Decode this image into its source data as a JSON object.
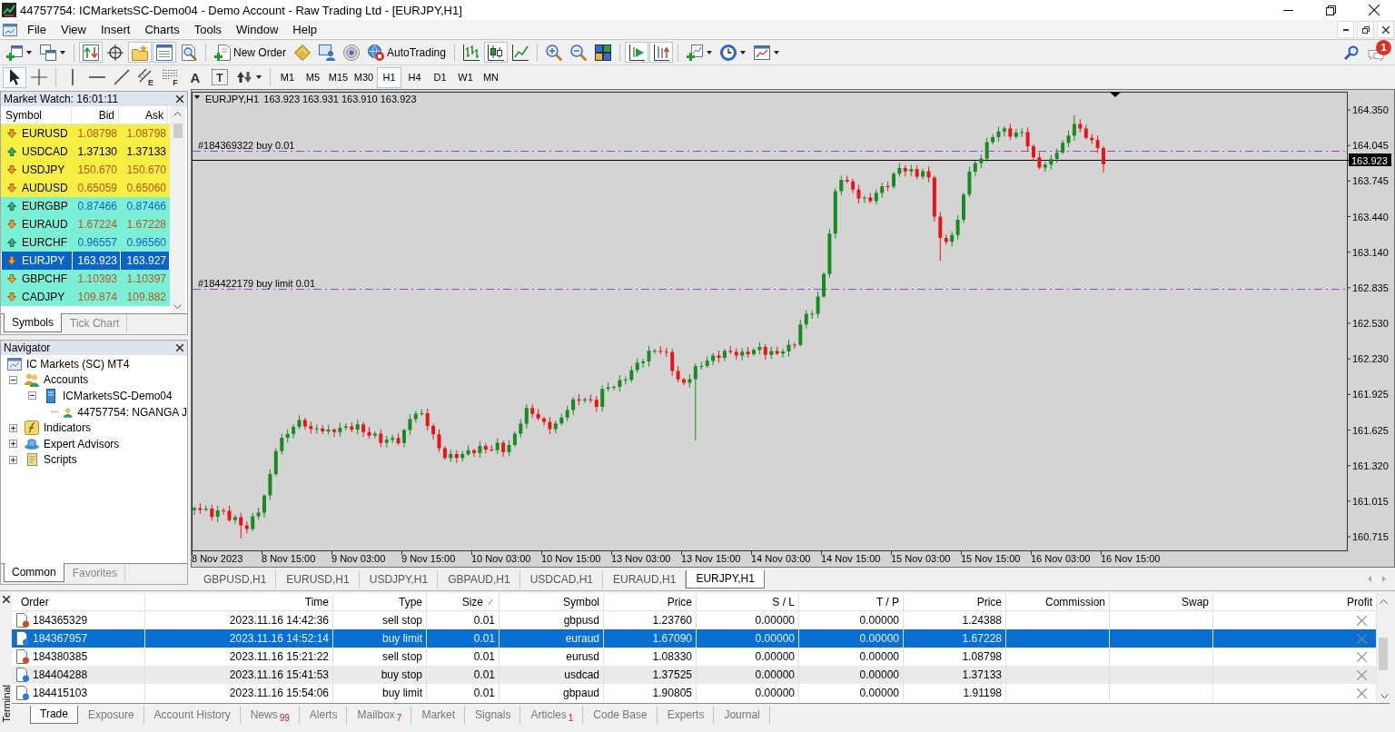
{
  "window": {
    "title": "44757754: ICMarketsSC-Demo04 - Demo Account - Raw Trading Ltd - [EURJPY,H1]"
  },
  "menu": [
    "File",
    "View",
    "Insert",
    "Charts",
    "Tools",
    "Window",
    "Help"
  ],
  "toolbar": [
    [
      {
        "kind": "newchart",
        "on": false
      },
      {
        "kind": "profiles",
        "on": false
      }
    ],
    [
      {
        "kind": "marketwatch",
        "on": true
      },
      {
        "kind": "datawindow",
        "on": false
      },
      {
        "kind": "navigator",
        "on": true
      },
      {
        "kind": "terminal",
        "on": true
      },
      {
        "kind": "tester",
        "on": false
      }
    ],
    [
      {
        "kind": "neworder",
        "label": "New Order",
        "on": false
      },
      {
        "kind": "editor",
        "on": false
      },
      {
        "kind": "signals",
        "on": false
      },
      {
        "kind": "vps",
        "on": false
      },
      {
        "kind": "autotrading",
        "label": "AutoTrading",
        "on": false
      }
    ],
    [
      {
        "kind": "bars",
        "on": false
      },
      {
        "kind": "candles",
        "on": true
      },
      {
        "kind": "line",
        "on": false
      }
    ],
    [
      {
        "kind": "zoomin",
        "on": false
      },
      {
        "kind": "zoomout",
        "on": false
      },
      {
        "kind": "tile",
        "on": false
      }
    ],
    [
      {
        "kind": "autoscroll",
        "on": true
      },
      {
        "kind": "shift",
        "on": true
      }
    ],
    [
      {
        "kind": "indicators",
        "on": false
      },
      {
        "kind": "periods",
        "on": false
      },
      {
        "kind": "templates",
        "on": false
      }
    ]
  ],
  "notifications": {
    "badge": "1"
  },
  "drawing_tools": [
    [
      {
        "kind": "cursor",
        "on": true
      },
      {
        "kind": "crosshair",
        "on": false
      }
    ],
    [
      {
        "kind": "vline",
        "on": false
      },
      {
        "kind": "hline",
        "on": false
      },
      {
        "kind": "trend",
        "on": false
      },
      {
        "kind": "channel",
        "glyph": "E",
        "on": false
      },
      {
        "kind": "fibo",
        "glyph": "F",
        "on": false
      },
      {
        "kind": "text",
        "glyph": "A",
        "on": false
      },
      {
        "kind": "label",
        "glyph": "T",
        "on": false
      },
      {
        "kind": "arrows",
        "on": false
      }
    ]
  ],
  "timeframes": [
    {
      "label": "M1",
      "selected": false
    },
    {
      "label": "M5",
      "selected": false
    },
    {
      "label": "M15",
      "selected": false
    },
    {
      "label": "M30",
      "selected": false
    },
    {
      "label": "H1",
      "selected": true
    },
    {
      "label": "H4",
      "selected": false
    },
    {
      "label": "D1",
      "selected": false
    },
    {
      "label": "W1",
      "selected": false
    },
    {
      "label": "MN",
      "selected": false
    }
  ],
  "market_watch": {
    "title": "Market Watch: 16:01:11",
    "columns": [
      "Symbol",
      "Bid",
      "Ask"
    ],
    "rows": [
      {
        "symbol": "EURUSD",
        "bid": "1.08798",
        "ask": "1.08798",
        "kind": "fall",
        "price_up": false,
        "price_down": true,
        "color": "#f6ee42",
        "selected": false
      },
      {
        "symbol": "USDCAD",
        "bid": "1.37130",
        "ask": "1.37133",
        "kind": "rise",
        "price_up": false,
        "price_down": false,
        "color": "#f6ee42",
        "selected": false
      },
      {
        "symbol": "USDJPY",
        "bid": "150.670",
        "ask": "150.670",
        "kind": "fall",
        "price_up": false,
        "price_down": true,
        "color": "#f6ee42",
        "selected": false
      },
      {
        "symbol": "AUDUSD",
        "bid": "0.65059",
        "ask": "0.65060",
        "kind": "fall",
        "price_up": false,
        "price_down": true,
        "color": "#f6ee42",
        "selected": false
      },
      {
        "symbol": "EURGBP",
        "bid": "0.87466",
        "ask": "0.87466",
        "kind": "rise",
        "price_up": true,
        "price_down": false,
        "color": "#7cf0d6",
        "selected": false
      },
      {
        "symbol": "EURAUD",
        "bid": "1.67224",
        "ask": "1.67228",
        "kind": "fall",
        "price_up": false,
        "price_down": true,
        "color": "#7cf0d6",
        "selected": false
      },
      {
        "symbol": "EURCHF",
        "bid": "0.96557",
        "ask": "0.96560",
        "kind": "rise",
        "price_up": true,
        "price_down": false,
        "color": "#7cf0d6",
        "selected": false
      },
      {
        "symbol": "EURJPY",
        "bid": "163.923",
        "ask": "163.927",
        "kind": "fall",
        "selected": true
      },
      {
        "symbol": "GBPCHF",
        "bid": "1.10393",
        "ask": "1.10397",
        "kind": "fall",
        "price_up": false,
        "price_down": true,
        "color": "#7cf0d6",
        "selected": false
      },
      {
        "symbol": "CADJPY",
        "bid": "109.874",
        "ask": "109.882",
        "kind": "fall",
        "price_up": false,
        "price_down": true,
        "color": "#7cf0d6",
        "selected": false
      }
    ],
    "tabs": [
      {
        "label": "Symbols",
        "selected": true
      },
      {
        "label": "Tick Chart",
        "selected": false
      }
    ]
  },
  "navigator": {
    "title": "Navigator",
    "tree": [
      {
        "label": "IC Markets (SC) MT4",
        "kind": "terminal",
        "children": [
          {
            "label": "Accounts",
            "kind": "accounts",
            "expanded": true,
            "children": [
              {
                "label": "ICMarketsSC-Demo04",
                "kind": "server",
                "expanded": true,
                "children": [
                  {
                    "label": "44757754: NGANGA J",
                    "kind": "account"
                  }
                ]
              }
            ]
          },
          {
            "label": "Indicators",
            "kind": "indicators",
            "expanded": false
          },
          {
            "label": "Expert Advisors",
            "kind": "experts",
            "expanded": false
          },
          {
            "label": "Scripts",
            "kind": "scripts",
            "expanded": false
          }
        ]
      }
    ],
    "tabs": [
      {
        "label": "Common",
        "selected": true
      },
      {
        "label": "Favorites",
        "selected": false
      }
    ]
  },
  "chart": {
    "symbol": "EURJPY,H1",
    "ohlc": "163.923 163.931 163.910 163.923",
    "orders": [
      {
        "label": "#184369322 buy 0.01"
      },
      {
        "label": "#184422179 buy limit 0.01"
      }
    ],
    "price_labels": [
      "164.350",
      "164.045",
      "163.745",
      "163.440",
      "163.140",
      "162.835",
      "162.530",
      "162.230",
      "161.925",
      "161.625",
      "161.320",
      "161.015",
      "160.715"
    ],
    "current_price": "163.923",
    "time_labels": [
      "8 Nov 2023",
      "8 Nov 15:00",
      "9 Nov 03:00",
      "9 Nov 15:00",
      "10 Nov 03:00",
      "10 Nov 15:00",
      "13 Nov 03:00",
      "13 Nov 15:00",
      "14 Nov 03:00",
      "14 Nov 15:00",
      "15 Nov 03:00",
      "15 Nov 15:00",
      "16 Nov 03:00",
      "16 Nov 15:00"
    ]
  },
  "chart_tabs": [
    {
      "label": "GBPUSD,H1",
      "selected": false
    },
    {
      "label": "EURUSD,H1",
      "selected": false
    },
    {
      "label": "USDJPY,H1",
      "selected": false
    },
    {
      "label": "GBPAUD,H1",
      "selected": false
    },
    {
      "label": "USDCAD,H1",
      "selected": false
    },
    {
      "label": "EURAUD,H1",
      "selected": false
    },
    {
      "label": "EURJPY,H1",
      "selected": true
    }
  ],
  "terminal": {
    "title": "Terminal",
    "columns": [
      {
        "label": "Order",
        "sorted": false
      },
      {
        "label": "Time",
        "sorted": false
      },
      {
        "label": "Type",
        "sorted": false
      },
      {
        "label": "Size",
        "sorted": true
      },
      {
        "label": "Symbol",
        "sorted": false
      },
      {
        "label": "Price",
        "sorted": false
      },
      {
        "label": "S / L",
        "sorted": false
      },
      {
        "label": "T / P",
        "sorted": false
      },
      {
        "label": "Price",
        "sorted": false
      },
      {
        "label": "Commission",
        "sorted": false
      },
      {
        "label": "Swap",
        "sorted": false
      },
      {
        "label": "Profit",
        "sorted": false
      }
    ],
    "rows": [
      {
        "kind": "sell",
        "selected": false,
        "order": "184365329",
        "time": "2023.11.16 14:42:36",
        "type": "sell stop",
        "size": "0.01",
        "symbol": "gbpusd",
        "price": "1.23760",
        "sl": "0.00000",
        "tp": "0.00000",
        "market_price": "1.24388"
      },
      {
        "kind": "buy",
        "selected": true,
        "order": "184367957",
        "time": "2023.11.16 14:52:14",
        "type": "buy limit",
        "size": "0.01",
        "symbol": "euraud",
        "price": "1.67090",
        "sl": "0.00000",
        "tp": "0.00000",
        "market_price": "1.67228"
      },
      {
        "kind": "sell",
        "selected": false,
        "order": "184380385",
        "time": "2023.11.16 15:21:22",
        "type": "sell stop",
        "size": "0.01",
        "symbol": "eurusd",
        "price": "1.08330",
        "sl": "0.00000",
        "tp": "0.00000",
        "market_price": "1.08798"
      },
      {
        "kind": "buy",
        "selected": false,
        "order": "184404288",
        "time": "2023.11.16 15:41:53",
        "type": "buy stop",
        "size": "0.01",
        "symbol": "usdcad",
        "price": "1.37525",
        "sl": "0.00000",
        "tp": "0.00000",
        "market_price": "1.37133"
      },
      {
        "kind": "buy",
        "selected": false,
        "order": "184415103",
        "time": "2023.11.16 15:54:06",
        "type": "buy limit",
        "size": "0.01",
        "symbol": "gbpaud",
        "price": "1.90805",
        "sl": "0.00000",
        "tp": "0.00000",
        "market_price": "1.91198"
      }
    ],
    "tabs": [
      {
        "label": "Trade",
        "selected": true
      },
      {
        "label": "Exposure",
        "selected": false
      },
      {
        "label": "Account History",
        "selected": false
      },
      {
        "label": "News",
        "badge": "99",
        "selected": false
      },
      {
        "label": "Alerts",
        "selected": false
      },
      {
        "label": "Mailbox",
        "badge": "7",
        "selected": false
      },
      {
        "label": "Market",
        "selected": false
      },
      {
        "label": "Signals",
        "selected": false
      },
      {
        "label": "Articles",
        "badge": "1",
        "selected": false
      },
      {
        "label": "Code Base",
        "selected": false
      },
      {
        "label": "Experts",
        "selected": false
      },
      {
        "label": "Journal",
        "selected": false
      }
    ]
  }
}
